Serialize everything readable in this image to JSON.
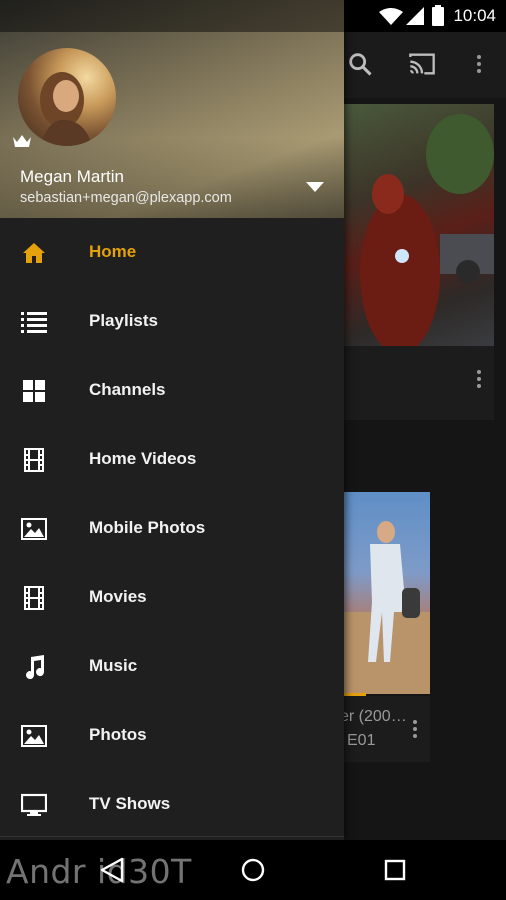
{
  "status_bar": {
    "time": "10:04"
  },
  "drawer": {
    "user": {
      "name": "Megan Martin",
      "email": "sebastian+megan@plexapp.com"
    },
    "nav_items": [
      {
        "label": "Home",
        "icon": "home-icon",
        "active": true
      },
      {
        "label": "Playlists",
        "icon": "list-icon",
        "active": false
      },
      {
        "label": "Channels",
        "icon": "grid-icon",
        "active": false
      },
      {
        "label": "Home Videos",
        "icon": "film-icon",
        "active": false
      },
      {
        "label": "Mobile Photos",
        "icon": "image-icon",
        "active": false
      },
      {
        "label": "Movies",
        "icon": "film-icon",
        "active": false
      },
      {
        "label": "Music",
        "icon": "music-note-icon",
        "active": false
      },
      {
        "label": "Photos",
        "icon": "image-icon",
        "active": false
      },
      {
        "label": "TV Shows",
        "icon": "monitor-icon",
        "active": false
      }
    ]
  },
  "background": {
    "card2_title": "er (200…",
    "card2_subtitle": "E01"
  },
  "watermark": "Andr id30T",
  "colors": {
    "accent": "#e5a00d",
    "drawer_bg": "#1f1f1f",
    "text": "#f2f2f2"
  }
}
